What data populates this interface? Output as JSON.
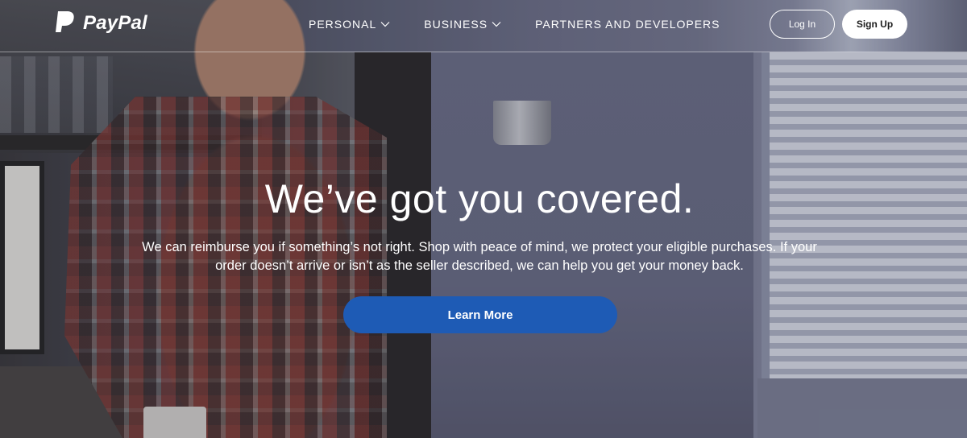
{
  "brand": {
    "name": "PayPal",
    "logo_icon": "paypal-p-icon"
  },
  "nav": {
    "items": [
      {
        "label": "PERSONAL",
        "has_dropdown": true
      },
      {
        "label": "BUSINESS",
        "has_dropdown": true
      },
      {
        "label": "PARTNERS AND DEVELOPERS",
        "has_dropdown": false
      }
    ]
  },
  "auth": {
    "login_label": "Log In",
    "signup_label": "Sign Up"
  },
  "hero": {
    "headline": "We’ve got you covered.",
    "subtext": "We can reimburse you if something’s not right. Shop with peace of mind, we protect your eligible purchases. If your order doesn’t arrive or isn’t as the seller described, we can help you get your money back.",
    "cta_label": "Learn More"
  },
  "colors": {
    "cta": "#1e5bb5",
    "text": "#ffffff"
  }
}
